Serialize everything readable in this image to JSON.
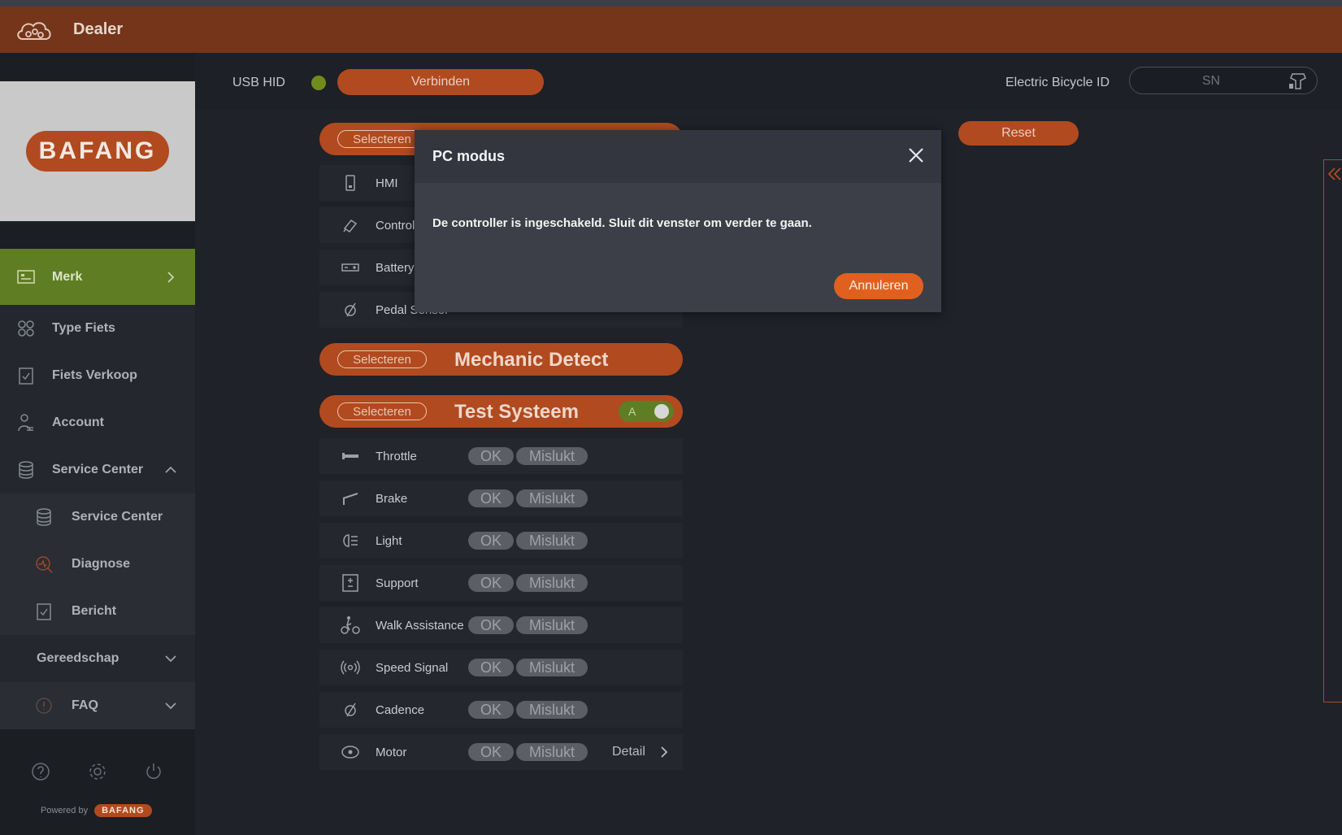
{
  "app": {
    "title": "Dealer"
  },
  "sidebar": {
    "logo_text": "BAFANG",
    "items": [
      {
        "label": "Merk",
        "icon": "image-icon",
        "active": true
      },
      {
        "label": "Type Fiets",
        "icon": "grid-icon"
      },
      {
        "label": "Fiets Verkoop",
        "icon": "clipboard-check-icon"
      },
      {
        "label": "Account",
        "icon": "user-icon"
      },
      {
        "label": "Service Center",
        "icon": "database-icon",
        "expanded": true
      },
      {
        "label": "Service Center",
        "icon": "database-icon",
        "sub": true
      },
      {
        "label": "Diagnose",
        "icon": "diagnose-icon",
        "sub": true
      },
      {
        "label": "Bericht",
        "icon": "clipboard-check-icon",
        "sub": true
      },
      {
        "label": "Gereedschap"
      },
      {
        "label": "FAQ",
        "icon": "info-icon"
      }
    ],
    "footer": {
      "powered_by": "Powered by",
      "brand": "BAFANG"
    }
  },
  "connection": {
    "interface": "USB HID",
    "status_color": "#6f8d1f",
    "connect_label": "Verbinden",
    "bike_id_label": "Electric Bicycle ID",
    "sn_placeholder": "SN"
  },
  "main": {
    "reset_label": "Reset",
    "select_label": "Selecteren",
    "top_rows": [
      {
        "label": "HMI"
      },
      {
        "label": "Control"
      },
      {
        "label": "Battery"
      },
      {
        "label": "Pedal Sensor"
      }
    ],
    "mechanic_section": {
      "title": "Mechanic Detect"
    },
    "test_section": {
      "title": "Test Systeem",
      "toggle_label": "A",
      "rows": [
        {
          "label": "Throttle",
          "ok": "OK",
          "fail": "Mislukt"
        },
        {
          "label": "Brake",
          "ok": "OK",
          "fail": "Mislukt"
        },
        {
          "label": "Light",
          "ok": "OK",
          "fail": "Mislukt"
        },
        {
          "label": "Support",
          "ok": "OK",
          "fail": "Mislukt"
        },
        {
          "label": "Walk Assistance",
          "ok": "OK",
          "fail": "Mislukt"
        },
        {
          "label": "Speed Signal",
          "ok": "OK",
          "fail": "Mislukt"
        },
        {
          "label": "Cadence",
          "ok": "OK",
          "fail": "Mislukt"
        },
        {
          "label": "Motor",
          "ok": "OK",
          "fail": "Mislukt",
          "detail": "Detail"
        }
      ]
    }
  },
  "modal": {
    "title": "PC modus",
    "message": "De controller is ingeschakeld. Sluit dit venster om verder te gaan.",
    "button": "Annuleren"
  },
  "colors": {
    "titlebar": "#74351a",
    "accent": "#b14a1f",
    "active": "#5f7d22",
    "modal_button": "#e0611f"
  }
}
